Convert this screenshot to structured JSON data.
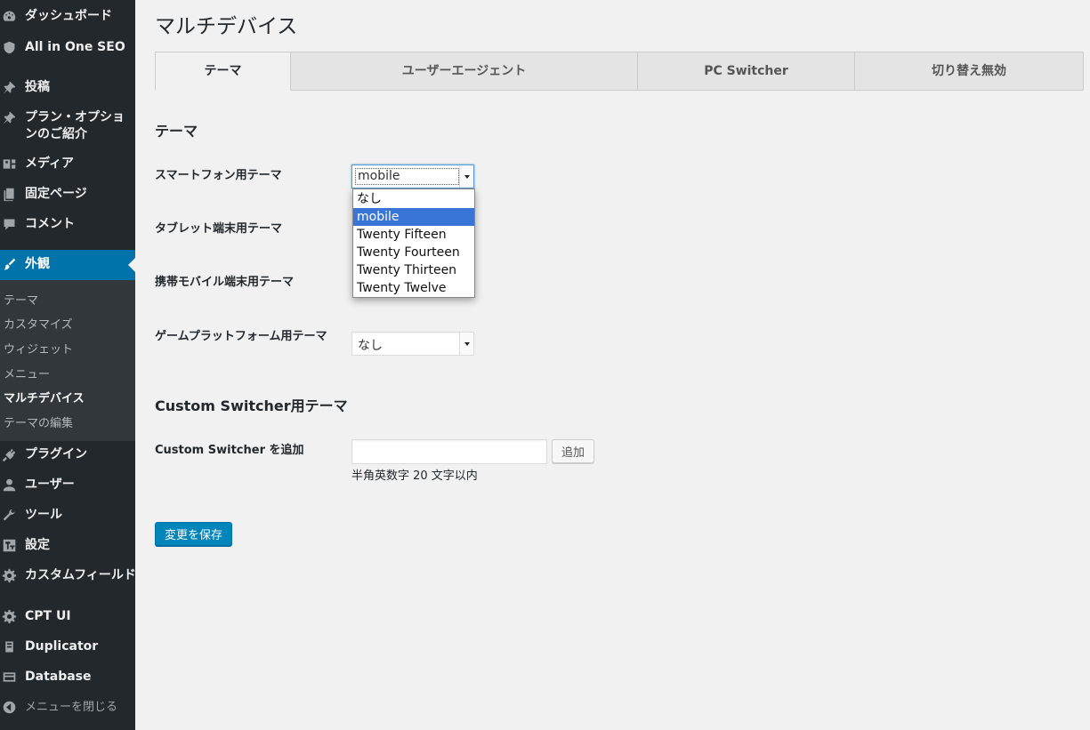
{
  "sidebar": {
    "items": [
      {
        "label": "ダッシュボード",
        "icon": "dashboard-icon"
      },
      {
        "label": "All in One SEO",
        "icon": "shield-icon"
      },
      {
        "label": "投稿",
        "icon": "pin-icon"
      },
      {
        "label": "プラン・オプションのご紹介",
        "icon": "pin-icon"
      },
      {
        "label": "メディア",
        "icon": "media-icon"
      },
      {
        "label": "固定ページ",
        "icon": "page-icon"
      },
      {
        "label": "コメント",
        "icon": "comment-icon"
      },
      {
        "label": "外観",
        "icon": "brush-icon"
      },
      {
        "label": "プラグイン",
        "icon": "plugin-icon"
      },
      {
        "label": "ユーザー",
        "icon": "user-icon"
      },
      {
        "label": "ツール",
        "icon": "wrench-icon"
      },
      {
        "label": "設定",
        "icon": "settings-icon"
      },
      {
        "label": "カスタムフィールド",
        "icon": "gear-icon"
      },
      {
        "label": "CPT UI",
        "icon": "gear-icon"
      },
      {
        "label": "Duplicator",
        "icon": "duplicator-icon"
      },
      {
        "label": "Database",
        "icon": "database-icon"
      },
      {
        "label": "メニューを閉じる",
        "icon": "collapse-icon"
      }
    ],
    "submenu": [
      "テーマ",
      "カスタマイズ",
      "ウィジェット",
      "メニュー",
      "マルチデバイス",
      "テーマの編集"
    ],
    "current_submenu": "マルチデバイス"
  },
  "page": {
    "title": "マルチデバイス"
  },
  "tabs": [
    "テーマ",
    "ユーザーエージェント",
    "PC Switcher",
    "切り替え無効"
  ],
  "active_tab": "テーマ",
  "theme_section": {
    "heading": "テーマ",
    "rows": [
      {
        "label": "スマートフォン用テーマ",
        "value": "mobile"
      },
      {
        "label": "タブレット端末用テーマ"
      },
      {
        "label": "携帯モバイル端末用テーマ"
      },
      {
        "label": "ゲームプラットフォーム用テーマ",
        "value": "なし"
      }
    ],
    "dropdown_options": [
      "なし",
      "mobile",
      "Twenty Fifteen",
      "Twenty Fourteen",
      "Twenty Thirteen",
      "Twenty Twelve"
    ],
    "dropdown_selected": "mobile"
  },
  "custom_section": {
    "heading": "Custom Switcher用テーマ",
    "add_label": "Custom Switcher を追加",
    "input_value": "",
    "add_button": "追加",
    "hint": "半角英数字 20 文字以内"
  },
  "save_button": "変更を保存",
  "colors": {
    "sidebar_bg": "#23282d",
    "active_bg": "#0073aa",
    "primary_button": "#0085ba",
    "dropdown_highlight": "#3875d7"
  }
}
